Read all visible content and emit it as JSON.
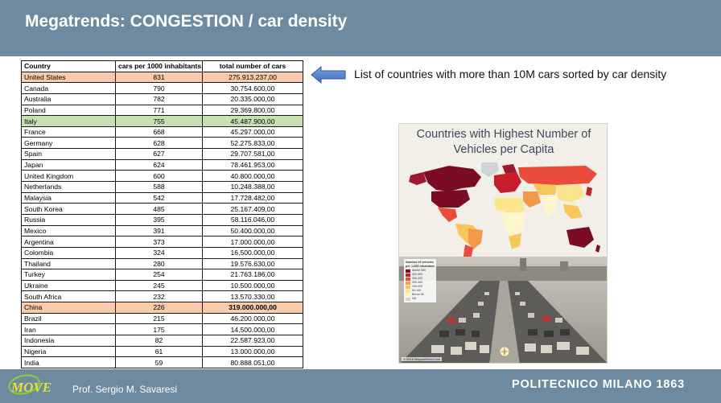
{
  "header": {
    "title": "Megatrends: CONGESTION / car density"
  },
  "table": {
    "columns": [
      "Country",
      "cars per 1000 inhabitants",
      "total number of cars"
    ],
    "rows": [
      {
        "country": "United States",
        "density": "831",
        "total": "275.913.237,00",
        "highlight": "orange",
        "bold_total": false
      },
      {
        "country": "Canada",
        "density": "790",
        "total": "30.754.600,00"
      },
      {
        "country": "Australia",
        "density": "782",
        "total": "20.335.000,00"
      },
      {
        "country": "Poland",
        "density": "771",
        "total": "29.369.800,00"
      },
      {
        "country": "Italy",
        "density": "755",
        "total": "45.487.900,00",
        "highlight": "green"
      },
      {
        "country": "France",
        "density": "668",
        "total": "45.297.000,00"
      },
      {
        "country": "Germany",
        "density": "628",
        "total": "52.275.833,00"
      },
      {
        "country": "Spain",
        "density": "627",
        "total": "29.707.581,00"
      },
      {
        "country": "Japan",
        "density": "624",
        "total": "78.461.953,00"
      },
      {
        "country": "United Kingdom",
        "density": "600",
        "total": "40.800.000,00"
      },
      {
        "country": "Netherlands",
        "density": "588",
        "total": "10.248.388,00"
      },
      {
        "country": "Malaysia",
        "density": "542",
        "total": "17.728.482,00"
      },
      {
        "country": "South Korea",
        "density": "485",
        "total": "25.167.409,00"
      },
      {
        "country": "Russia",
        "density": "395",
        "total": "58.116.046,00"
      },
      {
        "country": "Mexico",
        "density": "391",
        "total": "50.400.000,00"
      },
      {
        "country": "Argentina",
        "density": "373",
        "total": "17.000.000,00"
      },
      {
        "country": "Colombia",
        "density": "324",
        "total": "16.500.000,00"
      },
      {
        "country": "Thailand",
        "density": "280",
        "total": "19.576.630,00"
      },
      {
        "country": "Turkey",
        "density": "254",
        "total": "21.763.186,00"
      },
      {
        "country": "Ukraine",
        "density": "245",
        "total": "10.500.000,00"
      },
      {
        "country": "South Africa",
        "density": "232",
        "total": "13.570.330,00"
      },
      {
        "country": "China",
        "density": "226",
        "total": "319.000.000,00",
        "highlight": "orange",
        "bold_total": true
      },
      {
        "country": "Brazil",
        "density": "215",
        "total": "46.200.000,00"
      },
      {
        "country": "Iran",
        "density": "175",
        "total": "14.500.000,00"
      },
      {
        "country": "Indonesia",
        "density": "82",
        "total": "22.587.923,00"
      },
      {
        "country": "Nigeria",
        "density": "61",
        "total": "13.000.000,00"
      },
      {
        "country": "India",
        "density": "59",
        "total": "80.888.051,00"
      }
    ]
  },
  "annotation": {
    "text": "List of countries with more than 10M cars sorted by car density",
    "arrow_icon": "arrow-left-icon"
  },
  "poster": {
    "title_line1": "Countries with Highest Number of",
    "title_line2": "Vehicles per Capita",
    "legend_title": "Number of vehicles per 1,000 inhabitant",
    "legend": [
      {
        "label": "Above 500",
        "color": "#7b0c22"
      },
      {
        "label": "400-500",
        "color": "#c81e2c"
      },
      {
        "label": "300-400",
        "color": "#ea4b3c"
      },
      {
        "label": "200-300",
        "color": "#f39a4a"
      },
      {
        "label": "100-200",
        "color": "#f8c75a"
      },
      {
        "label": "50-100",
        "color": "#fbe58d"
      },
      {
        "label": "Below 50",
        "color": "#fdf6c8"
      },
      {
        "label": "NA",
        "color": "#cfd3d6"
      }
    ],
    "credit": "© 2016 MapsofWorld.com"
  },
  "footer": {
    "author": "Prof. Sergio M. Savaresi",
    "institution": "POLITECNICO MILANO 1863",
    "logo_text": "MOVE"
  },
  "colors": {
    "band": "#6e8aa1",
    "highlight_orange": "#f8cbad",
    "highlight_green": "#c6e0b4",
    "arrow": "#4472c4"
  }
}
